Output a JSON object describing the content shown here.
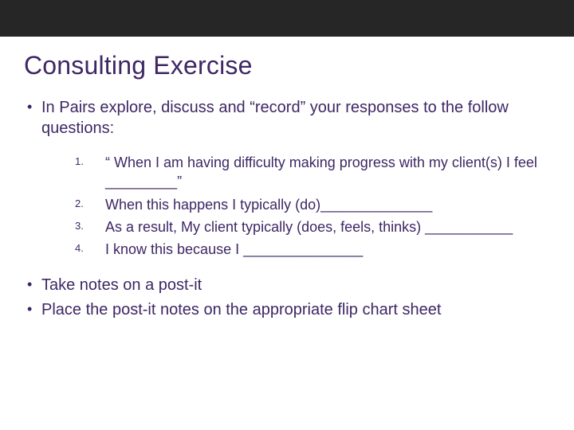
{
  "title": "Consulting Exercise",
  "bullets": {
    "b1": "In Pairs explore, discuss and “record” your responses to the follow questions:",
    "b2": "Take notes on a post-it",
    "b3": "Place the post-it notes on the appropriate flip chart sheet"
  },
  "numbered": {
    "n1_num": "1.",
    "n1": "“ When I am having difficulty making progress with my client(s) I feel _________”",
    "n2_num": "2.",
    "n2": "When this happens I typically (do)______________",
    "n3_num": "3.",
    "n3": "As a result, My client typically (does, feels, thinks) ___________",
    "n4_num": "4.",
    "n4": "I know this because I _______________"
  }
}
